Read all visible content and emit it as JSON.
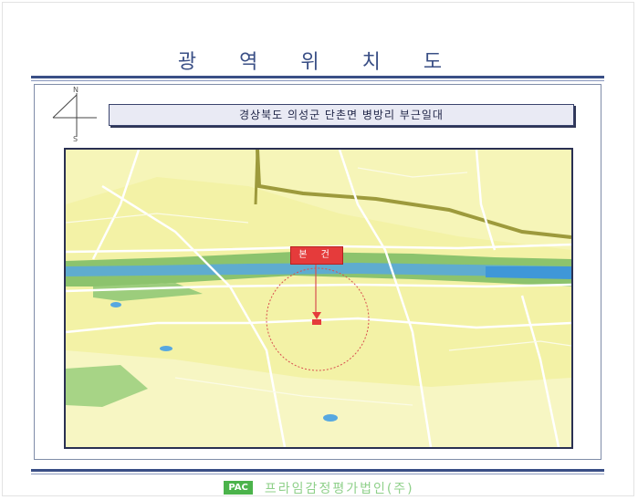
{
  "page": {
    "title": "광 역 위 치 도",
    "location": "경상북도 의성군 단촌면 병방리 부근일대",
    "compass": {
      "north": "N",
      "south": "S"
    },
    "site_marker": "본 건",
    "footer": {
      "logo": "PAC",
      "company": "프라임감정평가법인(주)"
    }
  },
  "colors": {
    "title": "#3a4f86",
    "map_background": "#f3f2a6",
    "river": "#57a8e0",
    "park": "#8cc36d",
    "site_marker": "#e53b3b"
  }
}
